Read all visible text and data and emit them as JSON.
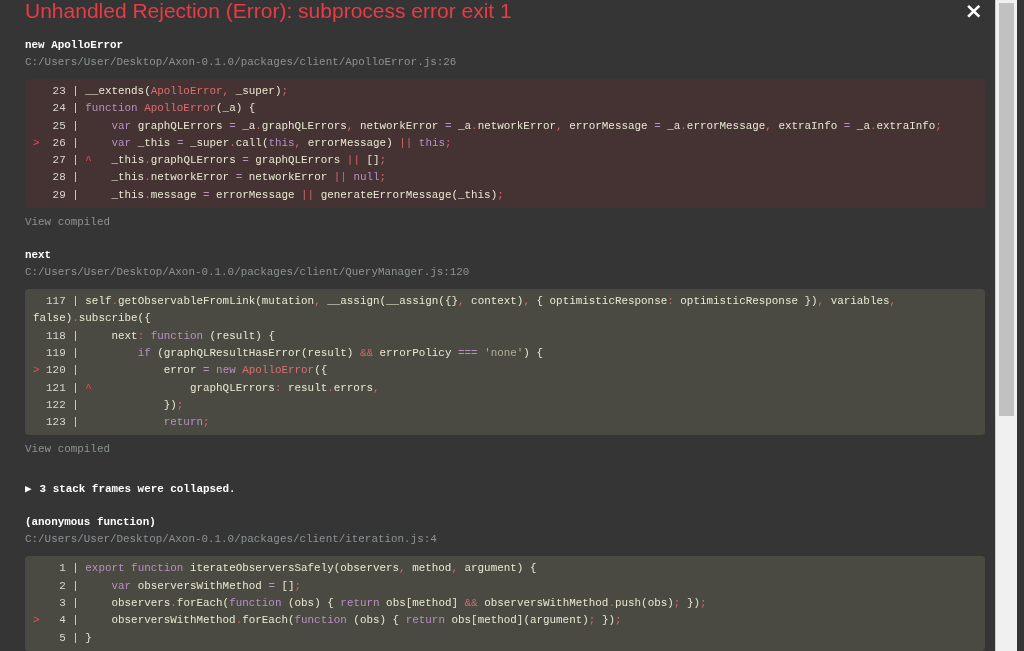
{
  "title": "Unhandled Rejection (Error): subprocess error exit 1",
  "close": "×",
  "frames": [
    {
      "kind": "frame",
      "function": "new ApolloError",
      "file": "C:/Users/User/Desktop/Axon-0.1.0/packages/client/ApolloError.js:26",
      "highlighted": true,
      "link": "View compiled",
      "lines": [
        {
          "number": "23",
          "bar": "|",
          "code": "__extends(ApolloError, _super);"
        },
        {
          "number": "24",
          "bar": "|",
          "code": "function ApolloError(_a) {"
        },
        {
          "number": "25",
          "bar": "|",
          "code": "    var graphQLErrors = _a.graphQLErrors, networkError = _a.networkError, errorMessage = _a.errorMessage, extraInfo = _a.extraInfo;"
        },
        {
          "pointer": ">",
          "number": "26",
          "bar": "|",
          "code": "    var _this = _super.call(this, errorMessage) || this;"
        },
        {
          "number": "27",
          "bar": "|",
          "caret": "^",
          "code": "  _this.graphQLErrors = graphQLErrors || [];"
        },
        {
          "number": "28",
          "bar": "|",
          "code": "    _this.networkError = networkError || null;"
        },
        {
          "number": "29",
          "bar": "|",
          "code": "    _this.message = errorMessage || generateErrorMessage(_this);"
        }
      ]
    },
    {
      "kind": "frame",
      "function": "next",
      "file": "C:/Users/User/Desktop/Axon-0.1.0/packages/client/QueryManager.js:120",
      "highlighted": false,
      "link": "View compiled",
      "lines": [
        {
          "number": "117",
          "bar": "|",
          "code": "self.getObservableFromLink(mutation, __assign(__assign({}, context), { optimisticResponse: optimisticResponse }), variables, false).subscribe({"
        },
        {
          "number": "118",
          "bar": "|",
          "code": "    next: function (result) {"
        },
        {
          "number": "119",
          "bar": "|",
          "code": "        if (graphQLResultHasError(result) && errorPolicy === 'none') {"
        },
        {
          "pointer": ">",
          "number": "120",
          "bar": "|",
          "code": "            error = new ApolloError({"
        },
        {
          "number": "121",
          "bar": "|",
          "caret": "^",
          "code": "              graphQLErrors: result.errors,"
        },
        {
          "number": "122",
          "bar": "|",
          "code": "            });"
        },
        {
          "number": "123",
          "bar": "|",
          "code": "            return;"
        }
      ]
    },
    {
      "kind": "collapsed",
      "toggle": "▶",
      "text": "3 stack frames were collapsed."
    },
    {
      "kind": "frame",
      "function": "(anonymous function)",
      "file": "C:/Users/User/Desktop/Axon-0.1.0/packages/client/iteration.js:4",
      "highlighted": false,
      "lines": [
        {
          "number": "1",
          "bar": "|",
          "code": "export function iterateObserversSafely(observers, method, argument) {"
        },
        {
          "number": "2",
          "bar": "|",
          "code": "    var observersWithMethod = [];"
        },
        {
          "number": "3",
          "bar": "|",
          "code": "    observers.forEach(function (obs) { return obs[method] && observersWithMethod.push(obs); });"
        },
        {
          "pointer": ">",
          "number": "4",
          "bar": "|",
          "code": "    observersWithMethod.forEach(function (obs) { return obs[method](argument); });"
        },
        {
          "number": "5",
          "bar": "|",
          "code": "}"
        }
      ]
    }
  ]
}
